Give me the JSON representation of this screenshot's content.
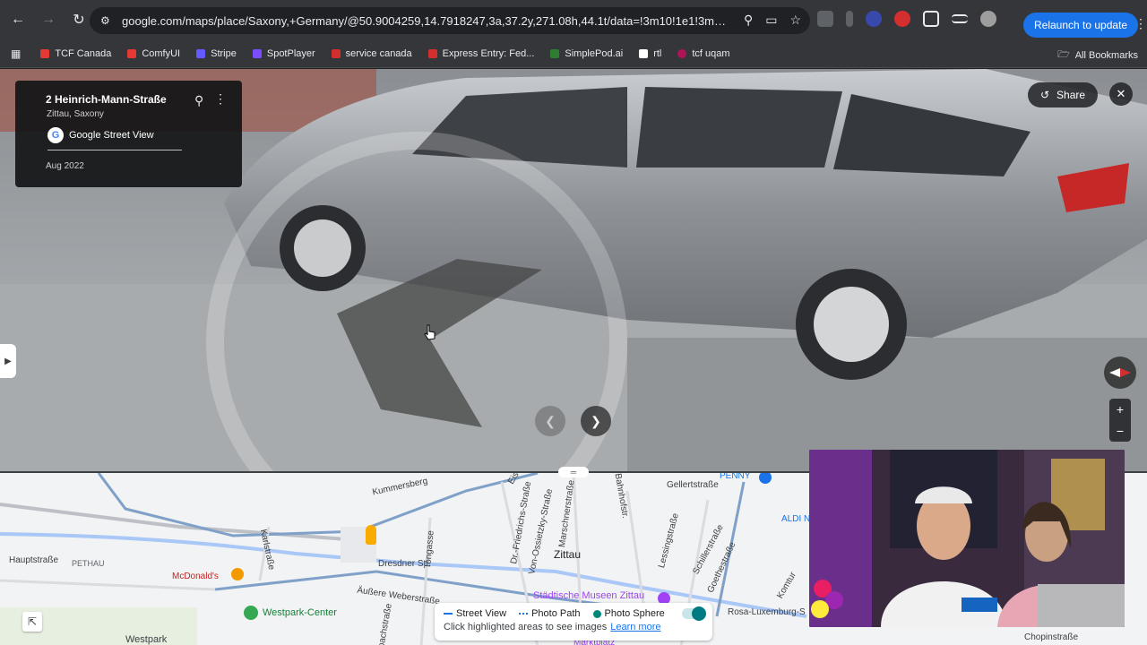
{
  "browser": {
    "url": "google.com/maps/place/Saxony,+Germany/@50.9004259,14.7918247,3a,37.2y,271.08h,44.1t/data=!3m10!1e1!3m8!1s...",
    "relaunch_label": "Relaunch to update",
    "bookmarks": [
      {
        "label": "TCF Canada",
        "color": "#e53935"
      },
      {
        "label": "ComfyUI",
        "color": "#e53935"
      },
      {
        "label": "Stripe",
        "color": "#635bff"
      },
      {
        "label": "SpotPlayer",
        "color": "#7c4dff"
      },
      {
        "label": "service canada",
        "color": "#d32f2f"
      },
      {
        "label": "Express Entry: Fed...",
        "color": "#d32f2f"
      },
      {
        "label": "SimplePod.ai",
        "color": "#2e7d32"
      },
      {
        "label": "rtl",
        "color": "#ffffff"
      },
      {
        "label": "tcf uqam",
        "color": "#ad1457"
      }
    ],
    "all_bookmarks_label": "All Bookmarks"
  },
  "streetview": {
    "address": "2 Heinrich-Mann-Straße",
    "city": "Zittau, Saxony",
    "provider": "Google Street View",
    "date": "Aug 2022",
    "share_label": "Share"
  },
  "map": {
    "labels": {
      "kummersberg": "Kummersberg",
      "hauptstrasse": "Hauptstraße",
      "pethau": "PETHAU",
      "mcdonalds": "McDonald's",
      "dresdner": "Dresdner Str.",
      "aussere": "Äußere Weberstraße",
      "westpark_center": "Westpark-Center",
      "westpark": "Westpark",
      "zittau": "Zittau",
      "museen": "Städtische Museen Zittau",
      "schiller": "Schillerstraße",
      "goethe": "Goethestraße",
      "gellert": "Gellertstraße",
      "bahnhof": "Bahnhofstr.",
      "lessing": "Lessingstraße",
      "penny": "PENNY",
      "aldi": "ALDI N",
      "rosa": "Rosa-Luxemburg-S",
      "chopin": "Chopinstraße",
      "marschner": "Marschnerstraße",
      "friedrichs": "Dr.-Friedrichs-Straße",
      "ossietzky": "Von-Ossietzky-Straße",
      "tongasse": "Tongasse",
      "karlstrasse": "Karlstraße",
      "eisen": "Eise",
      "bachstrasse": "bachstraße",
      "komtur": "Komtur",
      "markt": "Marktplatz"
    },
    "legend": {
      "street_view": "Street View",
      "photo_path": "Photo Path",
      "photo_sphere": "Photo Sphere",
      "hint": "Click highlighted areas to see images",
      "learn_more": "Learn more"
    },
    "colors": {
      "street_view": "#1a73e8",
      "photo_sphere": "#00897b"
    }
  }
}
